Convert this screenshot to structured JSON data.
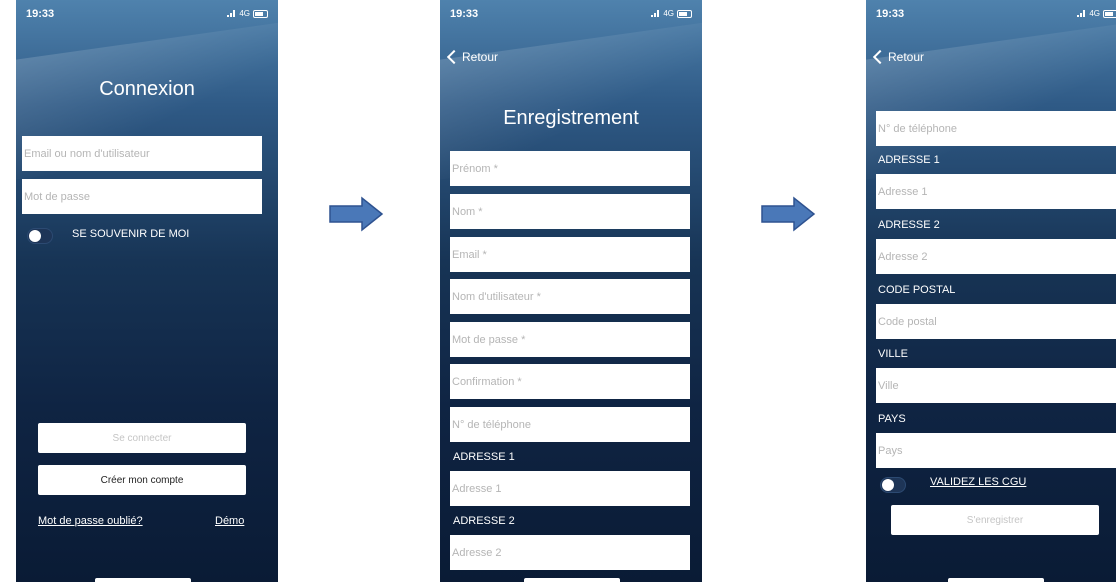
{
  "colors": {
    "accent": "#4a78b8",
    "field_bg": "#ffffff",
    "bg_top": "#4f82ad",
    "bg_bottom": "#0a1b35"
  },
  "status": {
    "time": "19:33",
    "network": "4G"
  },
  "screen1": {
    "title": "Connexion",
    "email_placeholder": "Email ou nom d'utilisateur",
    "password_placeholder": "Mot de passe",
    "remember_label": "SE SOUVENIR DE MOI",
    "login_button": "Se connecter",
    "create_button": "Créer mon compte",
    "forgot_link": "Mot de passe oublié?",
    "demo_link": "Démo"
  },
  "screen2": {
    "back_label": "Retour",
    "title": "Enregistrement",
    "fields": [
      "Prénom *",
      "Nom *",
      "Email *",
      "Nom d'utilisateur *",
      "Mot de passe *",
      "Confirmation *",
      "N° de téléphone"
    ],
    "section_address1": "ADRESSE 1",
    "address1_placeholder": "Adresse 1",
    "section_address2": "ADRESSE 2",
    "address2_placeholder": "Adresse 2"
  },
  "screen3": {
    "back_label": "Retour",
    "phone_placeholder": "N° de téléphone",
    "section_address1": "ADRESSE 1",
    "address1_placeholder": "Adresse 1",
    "section_address2": "ADRESSE 2",
    "address2_placeholder": "Adresse 2",
    "section_postal": "CODE POSTAL",
    "postal_placeholder": "Code postal",
    "section_city": "VILLE",
    "city_placeholder": "Ville",
    "section_country": "PAYS",
    "country_placeholder": "Pays",
    "cgu_label": "VALIDEZ LES CGU",
    "register_button": "S'enregistrer"
  },
  "icons": {
    "back": "chevron-left-icon",
    "flow_arrow": "arrow-right-icon"
  }
}
